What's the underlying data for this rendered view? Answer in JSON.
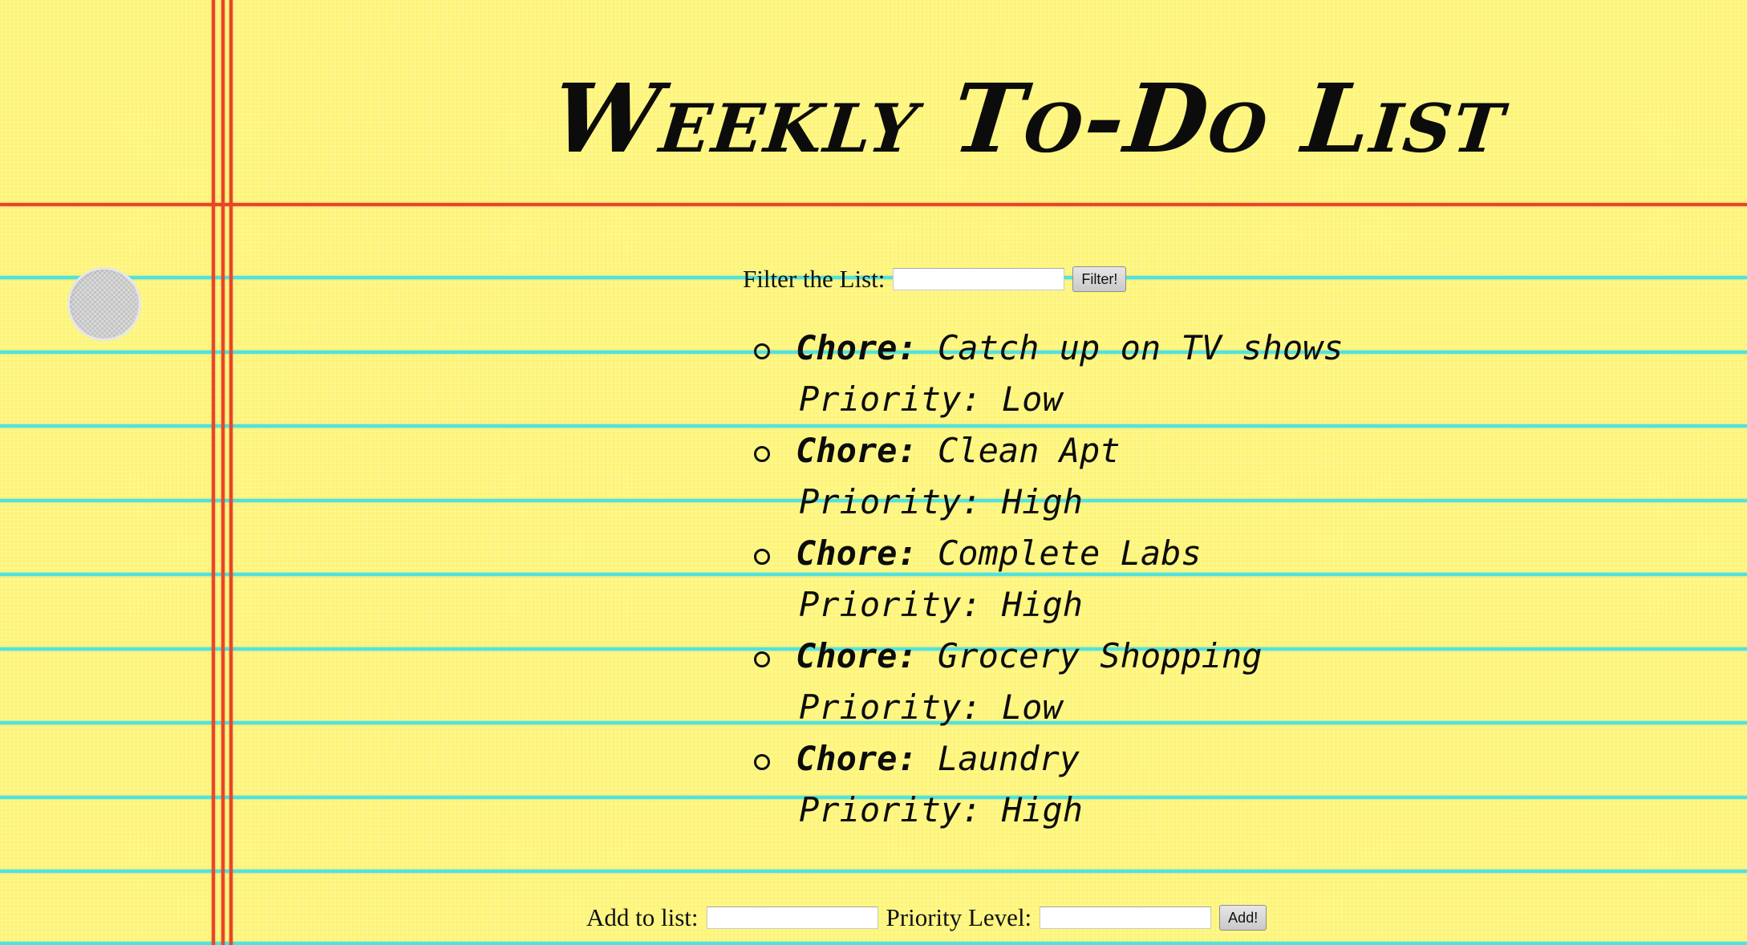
{
  "page": {
    "title": "Weekly To-Do List"
  },
  "filter": {
    "label": "Filter the List:",
    "input_value": "",
    "input_placeholder": "",
    "button_label": "Filter!"
  },
  "todos": [
    {
      "chore_label": "Chore:",
      "chore": "Catch up on TV shows",
      "priority_label": "Priority:",
      "priority": "Low"
    },
    {
      "chore_label": "Chore:",
      "chore": "Clean Apt",
      "priority_label": "Priority:",
      "priority": "High"
    },
    {
      "chore_label": "Chore:",
      "chore": "Complete Labs",
      "priority_label": "Priority:",
      "priority": "High"
    },
    {
      "chore_label": "Chore:",
      "chore": "Grocery Shopping",
      "priority_label": "Priority:",
      "priority": "Low"
    },
    {
      "chore_label": "Chore:",
      "chore": "Laundry",
      "priority_label": "Priority:",
      "priority": "High"
    }
  ],
  "add_form": {
    "item_label": "Add to list:",
    "item_value": "",
    "priority_label": "Priority Level:",
    "priority_value": "",
    "button_label": "Add!"
  },
  "colors": {
    "paper": "#fdf57a",
    "rule_line": "#4fe3e0",
    "margin_line": "#e8462a",
    "ink": "#0c0c0c"
  }
}
